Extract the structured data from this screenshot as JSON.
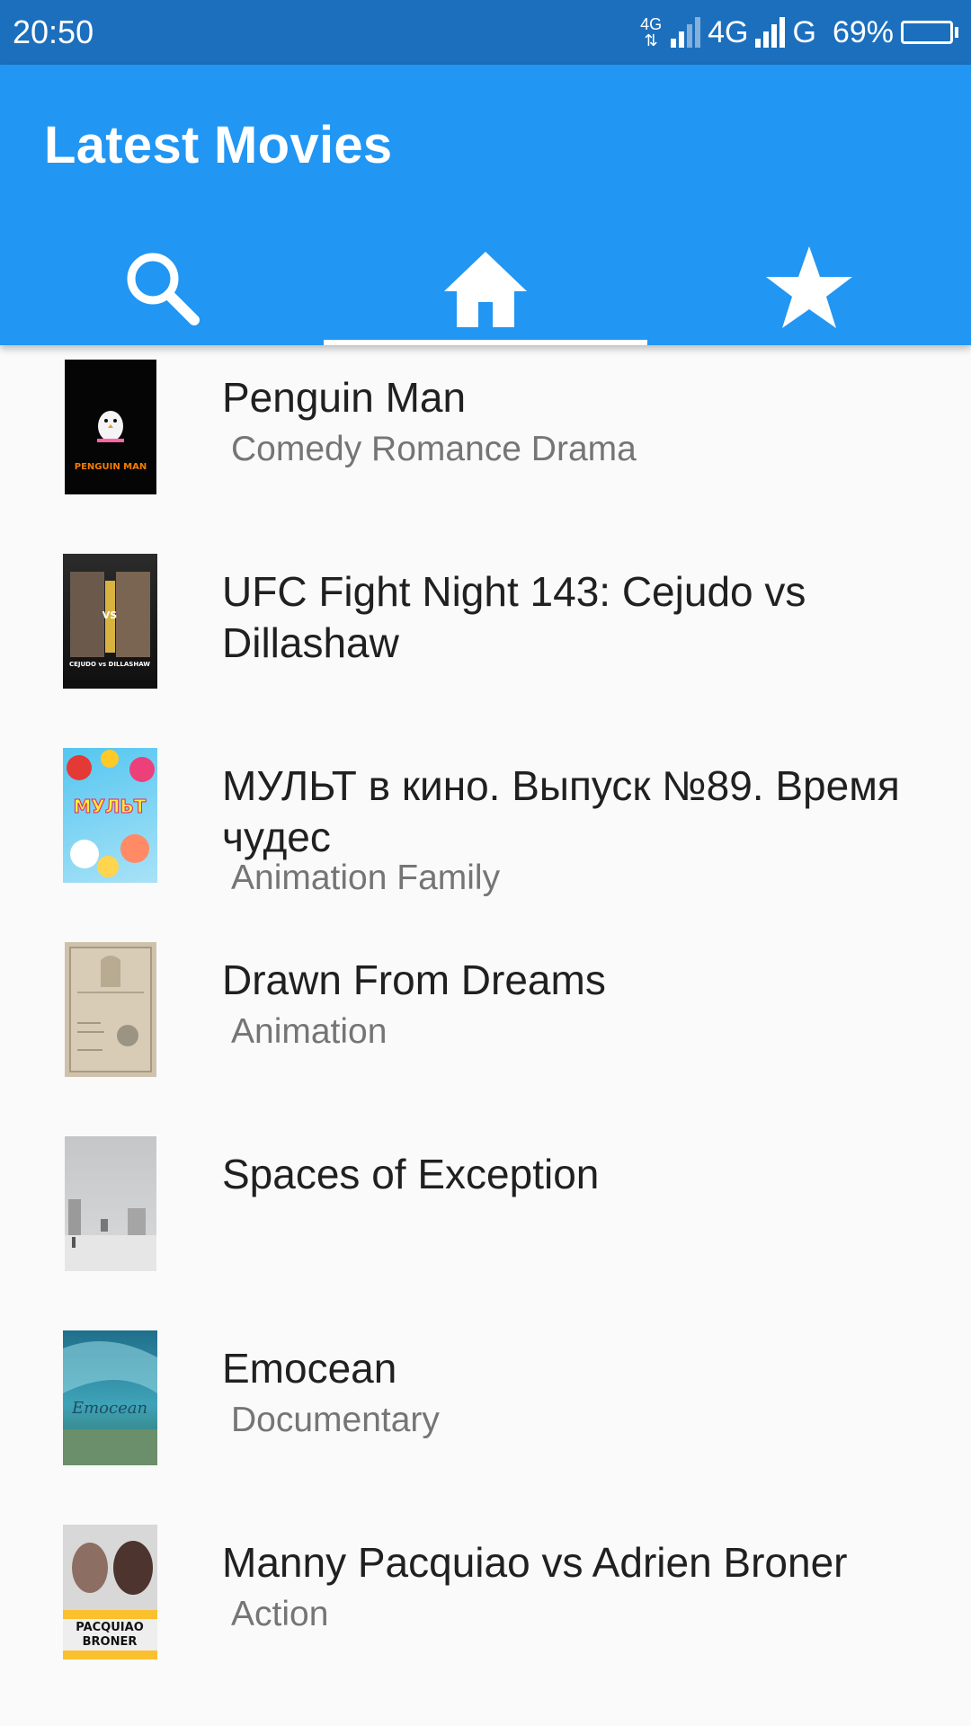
{
  "status_bar": {
    "time": "20:50",
    "network_small": "4G",
    "network_1": "4G",
    "network_2": "G",
    "battery": "69%",
    "battery_level": 0.69
  },
  "app": {
    "title": "Latest Movies"
  },
  "tabs": [
    {
      "icon": "search-icon",
      "selected": false
    },
    {
      "icon": "home-icon",
      "selected": true
    },
    {
      "icon": "star-icon",
      "selected": false
    }
  ],
  "movies": [
    {
      "title": "Penguin Man",
      "genres": "Comedy Romance Drama"
    },
    {
      "title": "UFC Fight Night 143: Cejudo vs Dillashaw",
      "genres": ""
    },
    {
      "title": "МУЛЬТ в кино. Выпуск №89. Время чудес",
      "genres": "Animation Family"
    },
    {
      "title": "Drawn From Dreams",
      "genres": "Animation"
    },
    {
      "title": "Spaces of Exception",
      "genres": ""
    },
    {
      "title": "Emocean",
      "genres": "Documentary"
    },
    {
      "title": "Manny Pacquiao vs Adrien Broner",
      "genres": "Action"
    }
  ],
  "poster_text": {
    "penguin_man": "PENGUIN MAN",
    "ufc": "CEJUDO vs DILLASHAW",
    "mult": "МУЛЬТ",
    "emocean": "Emocean",
    "pacquiao": "PACQUIAO",
    "broner": "BRONER"
  },
  "colors": {
    "status_bar": "#1c6fbd",
    "app_bar": "#2196f3",
    "background": "#fafafa",
    "title_text": "#202020",
    "genre_text": "#757575"
  }
}
